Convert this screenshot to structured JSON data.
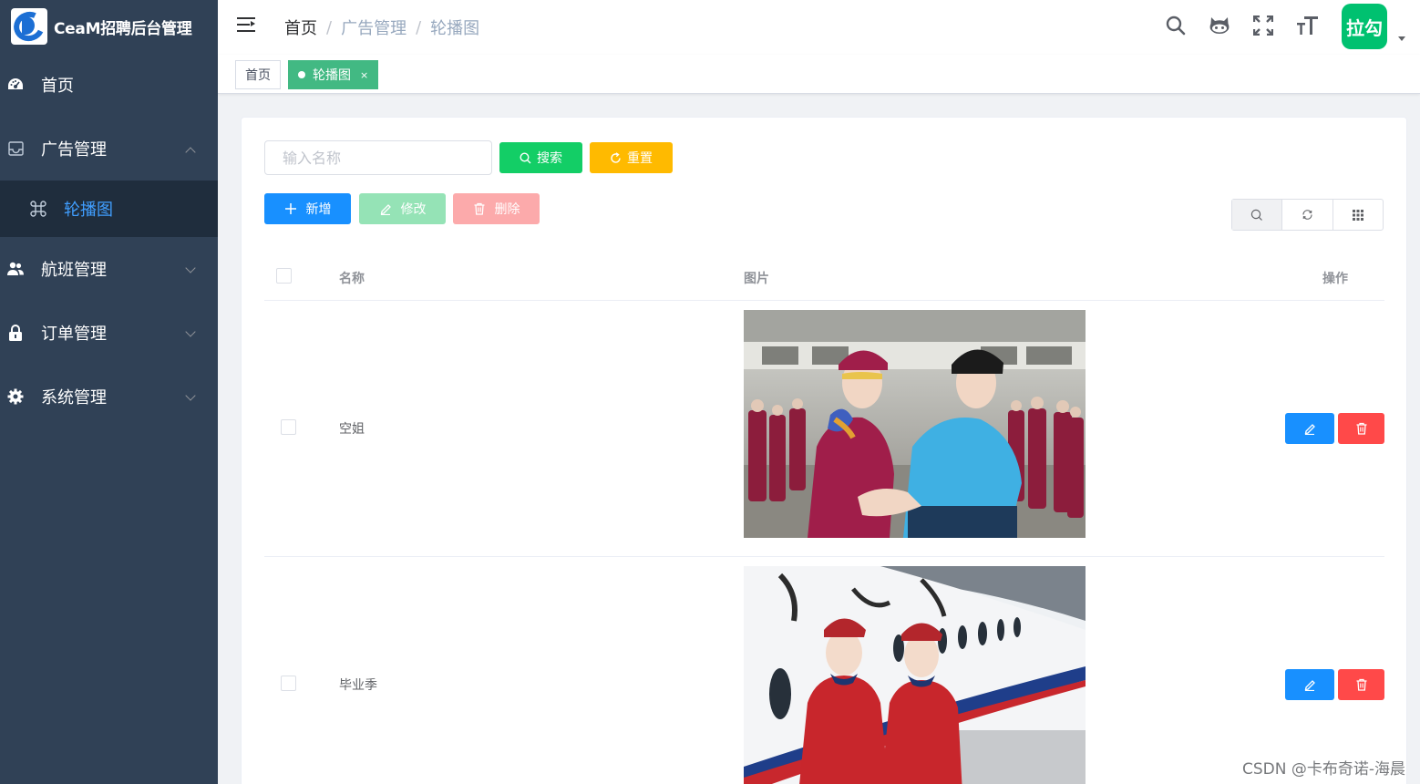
{
  "app": {
    "title": "CeaM招聘后台管理"
  },
  "sidebar": {
    "items": [
      {
        "label": "首页"
      },
      {
        "label": "广告管理",
        "expanded": true,
        "children": [
          {
            "label": "轮播图",
            "active": true
          }
        ]
      },
      {
        "label": "航班管理"
      },
      {
        "label": "订单管理"
      },
      {
        "label": "系统管理"
      }
    ]
  },
  "header": {
    "breadcrumb": [
      "首页",
      "广告管理",
      "轮播图"
    ],
    "separator": "/",
    "avatar_text": "拉勾",
    "icons": [
      "menu-fold-icon",
      "search-icon",
      "github-icon",
      "fullscreen-icon",
      "font-size-icon"
    ]
  },
  "tags": {
    "home": "首页",
    "active": "轮播图",
    "close": "×"
  },
  "toolbar": {
    "search_placeholder": "输入名称",
    "search_label": "搜索",
    "reset_label": "重置",
    "add_label": "新增",
    "edit_label": "修改",
    "delete_label": "删除"
  },
  "table": {
    "columns": [
      "名称",
      "图片",
      "操作"
    ],
    "rows": [
      {
        "name": "空姐",
        "image": "flight-attendants-training-photo"
      },
      {
        "name": "毕业季",
        "image": "flight-attendants-airplane-photo"
      }
    ]
  },
  "colors": {
    "sidebar_bg": "#304156",
    "submenu_bg": "#1f2d3d",
    "accent_blue": "#1890ff",
    "success_green": "#13ce66",
    "warning_yellow": "#ffba00",
    "danger_red": "#ff4949",
    "tag_green": "#42b983",
    "avatar_green": "#00c170"
  },
  "watermark": "CSDN @卡布奇诺-海晨"
}
